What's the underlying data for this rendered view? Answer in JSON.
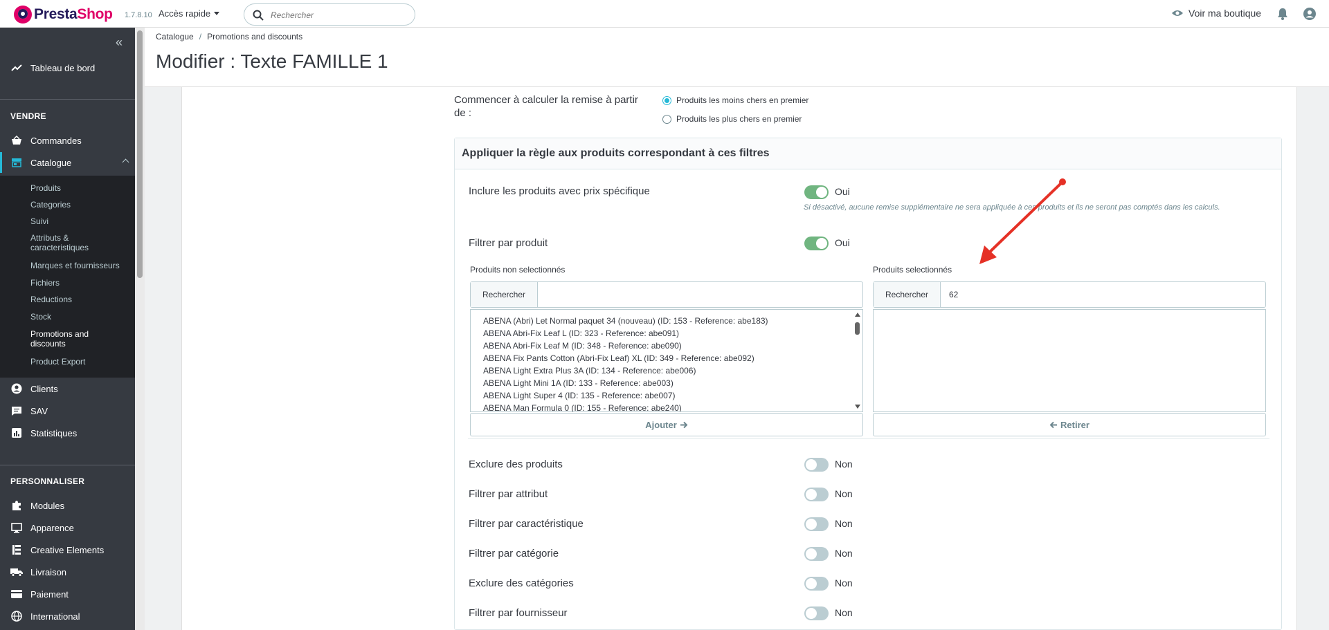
{
  "header": {
    "logo_part1": "Presta",
    "logo_part2": "Shop",
    "version": "1.7.8.10",
    "quick_access": "Accès rapide",
    "search_placeholder": "Rechercher",
    "view_shop": "Voir ma boutique"
  },
  "sidebar": {
    "dashboard": "Tableau de bord",
    "section_sell": "VENDRE",
    "orders": "Commandes",
    "catalog": "Catalogue",
    "catalog_sub": [
      "Produits",
      "Categories",
      "Suivi",
      "Attributs &",
      "caracteristiques",
      "Marques et fournisseurs",
      "Fichiers",
      "Reductions",
      "Stock",
      "Promotions and",
      "discounts",
      "Product Export"
    ],
    "clients": "Clients",
    "sav": "SAV",
    "stats": "Statistiques",
    "section_customize": "PERSONNALISER",
    "modules": "Modules",
    "appearance": "Apparence",
    "creative": "Creative Elements",
    "shipping": "Livraison",
    "payment": "Paiement",
    "international": "International"
  },
  "breadcrumb": {
    "level1": "Catalogue",
    "level2": "Promotions and discounts"
  },
  "page_title": "Modifier : Texte FAMILLE 1",
  "form": {
    "start_label_line1": "Commencer à calculer la remise à partir",
    "start_label_line2": "de :",
    "radio_cheapest": "Produits les moins chers en premier",
    "radio_expensive": "Produits les plus chers en premier",
    "panel_title": "Appliquer la règle aux produits correspondant à ces filtres",
    "include_specific": "Inclure les produits avec prix spécifique",
    "include_specific_value": "Oui",
    "include_hint": "Si désactivé, aucune remise supplémentaire ne sera appliquée à ces produits et ils ne seront pas comptés dans les calculs.",
    "filter_product": "Filtrer par produit",
    "filter_product_value": "Oui",
    "unselected_title": "Produits non selectionnés",
    "selected_title": "Produits selectionnés",
    "search_btn": "Rechercher",
    "search_left_value": "",
    "search_right_value": "62",
    "products": [
      "ABENA (Abri) Let Normal paquet 34 (nouveau) (ID: 153 - Reference: abe183)",
      "ABENA Abri-Fix Leaf L (ID: 323 - Reference: abe091)",
      "ABENA Abri-Fix Leaf M (ID: 348 - Reference: abe090)",
      "ABENA Fix Pants Cotton (Abri-Fix Leaf) XL (ID: 349 - Reference: abe092)",
      "ABENA Light Extra Plus 3A (ID: 134 - Reference: abe006)",
      "ABENA Light Mini 1A (ID: 133 - Reference: abe003)",
      "ABENA Light Super 4 (ID: 135 - Reference: abe007)",
      "ABENA Man Formula 0 (ID: 155 - Reference: abe240)"
    ],
    "add_btn": "Ajouter",
    "remove_btn": "Retirer",
    "exclude_products": "Exclure des produits",
    "filter_attribute": "Filtrer par attribut",
    "filter_feature": "Filtrer par caractéristique",
    "filter_category": "Filtrer par catégorie",
    "exclude_categories": "Exclure des catégories",
    "filter_supplier": "Filtrer par fournisseur",
    "off_value": "Non"
  }
}
